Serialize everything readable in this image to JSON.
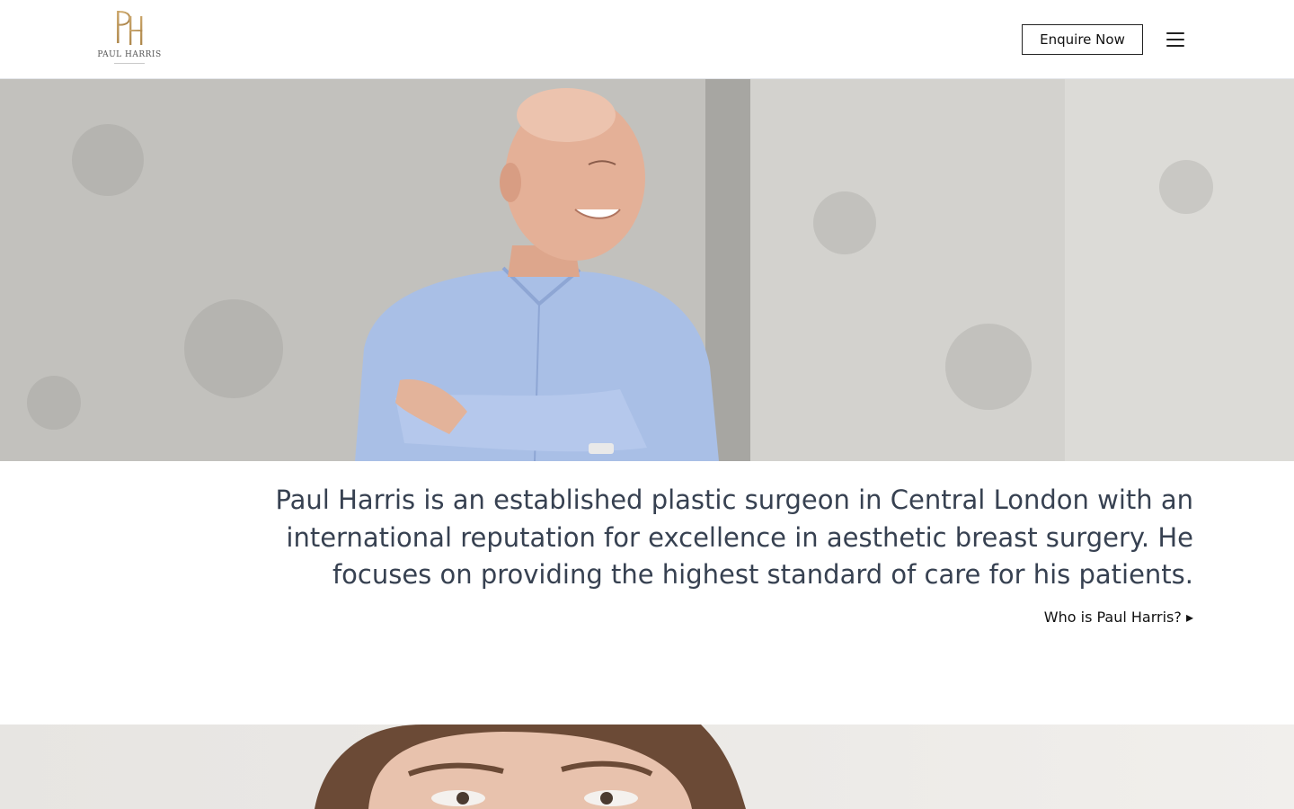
{
  "header": {
    "logo_monogram": "PH",
    "logo_name": "PAUL HARRIS",
    "enquire_label": "Enquire Now",
    "menu_icon": "hamburger-menu-icon"
  },
  "hero": {
    "image": "photo-surgeon-portrait"
  },
  "intro": {
    "text": "Paul Harris is an established plastic surgeon in Central London with an international reputation for excellence in aesthetic breast surgery. He focuses on providing the highest standard of care for his patients.",
    "link_label": "Who is Paul Harris? ▸"
  },
  "second_section": {
    "image": "photo-woman-portrait"
  },
  "colors": {
    "brand_gold": "#b8955a",
    "text": "#374151",
    "shirt": "#a9bfe6"
  }
}
